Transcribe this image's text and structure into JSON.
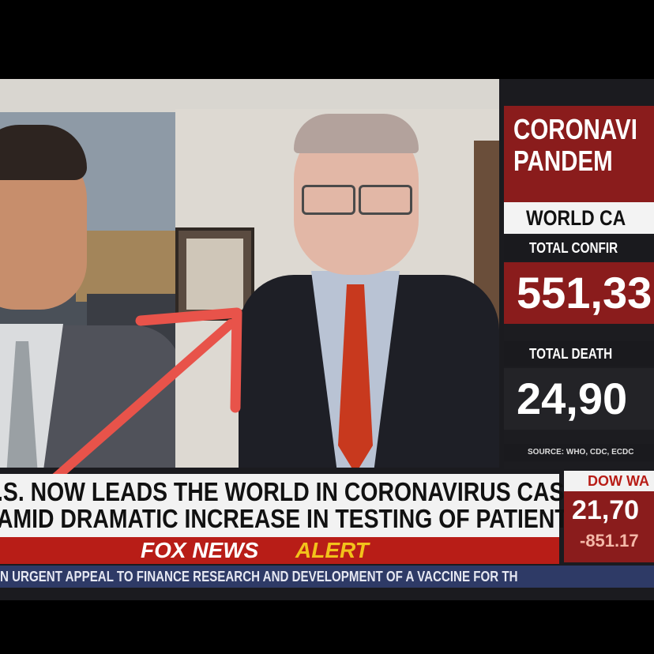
{
  "graphic": {
    "title_line1": "CORONAVI",
    "title_line2": "PANDEM",
    "subtitle": "WORLD CA",
    "confirmed_label": "TOTAL CONFIR",
    "confirmed_value": "551,33",
    "deaths_label": "TOTAL DEATH",
    "deaths_value": "24,90",
    "source": "SOURCE: WHO, CDC, ECDC"
  },
  "lower_third": {
    "headline_line1": ".S. NOW LEADS THE WORLD IN CORONAVIRUS CASES",
    "headline_line2": "AMID DRAMATIC INCREASE IN TESTING OF PATIENTS",
    "brand": "FOX NEWS",
    "alert": "ALERT"
  },
  "ticker": {
    "label": "DOW WA",
    "value": "21,70",
    "change": "-851.17"
  },
  "crawl": {
    "text": "N URGENT APPEAL TO FINANCE RESEARCH AND DEVELOPMENT OF A VACCINE FOR TH"
  },
  "colors": {
    "fox_red": "#b81d17",
    "graphic_red": "#8a1c1c",
    "alert_yellow": "#f2c21b",
    "crawl_blue": "#2e3a66",
    "arrow": "#e8534a"
  }
}
